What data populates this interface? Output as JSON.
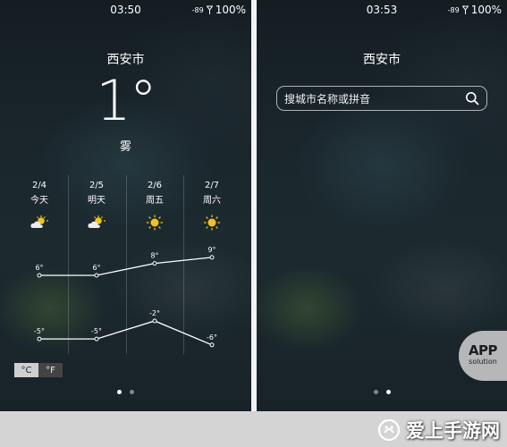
{
  "left_screen": {
    "status": {
      "time": "03:50",
      "signal": "-89",
      "battery": "100%"
    },
    "city": "西安市",
    "current_temp": "1°",
    "condition": "雾",
    "forecast": [
      {
        "date": "2/4",
        "day": "今天",
        "icon": "partly-cloudy-icon",
        "high": "6°",
        "low": "-5°",
        "high_val": 6,
        "low_val": -5
      },
      {
        "date": "2/5",
        "day": "明天",
        "icon": "partly-cloudy-icon",
        "high": "6°",
        "low": "-5°",
        "high_val": 6,
        "low_val": -5
      },
      {
        "date": "2/6",
        "day": "周五",
        "icon": "sun-icon",
        "high": "8°",
        "low": "-2°",
        "high_val": 8,
        "low_val": -2
      },
      {
        "date": "2/7",
        "day": "周六",
        "icon": "sun-icon",
        "high": "9°",
        "low": "-6°",
        "high_val": 9,
        "low_val": -6
      }
    ],
    "units": {
      "celsius": "°C",
      "fahrenheit": "°F",
      "selected": "celsius"
    },
    "page_indicator": {
      "count": 2,
      "active": 1
    }
  },
  "right_screen": {
    "status": {
      "time": "03:53",
      "signal": "-89",
      "battery": "100%"
    },
    "city": "西安市",
    "search_placeholder": "搜城市名称或拼音",
    "page_indicator": {
      "count": 2,
      "active": 2
    }
  },
  "watermark": {
    "badge_line1": "APP",
    "badge_line2": "solution",
    "footer": "爱上手游网"
  },
  "colors": {
    "sun": "#f4c21c",
    "cloud": "#e8e8e8",
    "line": "#ffffff",
    "unit_active_bg": "#cfcfcf",
    "unit_inactive_bg": "#444444"
  }
}
